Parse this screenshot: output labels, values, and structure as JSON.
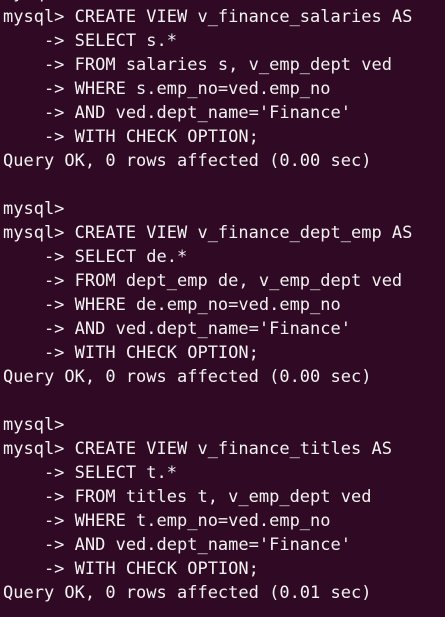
{
  "terminal": {
    "background": "#300a24",
    "lines": [
      "mysql>",
      "mysql> CREATE VIEW v_finance_salaries AS",
      "    -> SELECT s.*",
      "    -> FROM salaries s, v_emp_dept ved",
      "    -> WHERE s.emp_no=ved.emp_no",
      "    -> AND ved.dept_name='Finance'",
      "    -> WITH CHECK OPTION;",
      "Query OK, 0 rows affected (0.00 sec)",
      "",
      "mysql>",
      "mysql> CREATE VIEW v_finance_dept_emp AS",
      "    -> SELECT de.*",
      "    -> FROM dept_emp de, v_emp_dept ved",
      "    -> WHERE de.emp_no=ved.emp_no",
      "    -> AND ved.dept_name='Finance'",
      "    -> WITH CHECK OPTION;",
      "Query OK, 0 rows affected (0.00 sec)",
      "",
      "mysql>",
      "mysql> CREATE VIEW v_finance_titles AS",
      "    -> SELECT t.*",
      "    -> FROM titles t, v_emp_dept ved",
      "    -> WHERE t.emp_no=ved.emp_no",
      "    -> AND ved.dept_name='Finance'",
      "    -> WITH CHECK OPTION;",
      "Query OK, 0 rows affected (0.01 sec)"
    ]
  }
}
